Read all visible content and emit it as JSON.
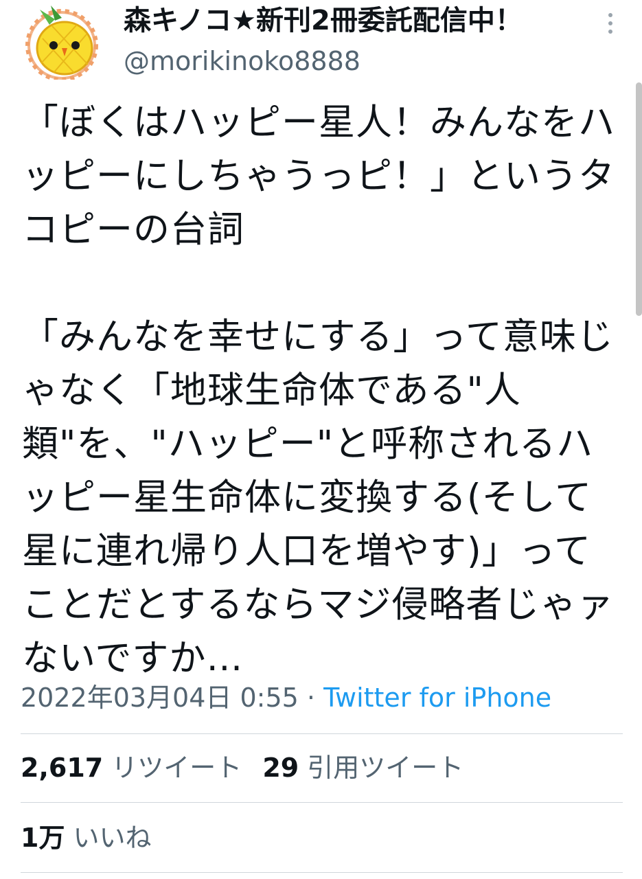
{
  "user": {
    "display_name": "森キノコ★新刊2冊委託配信中！",
    "handle": "@morikinoko8888",
    "avatar_icon": "pineapple-bird-icon"
  },
  "tweet": {
    "text": "「ぼくはハッピー星人！みんなをハッピーにしちゃうっピ！」というタコピーの台詞\n\n「みんなを幸せにする」って意味じゃなく「地球生命体である\"人類\"を、\"ハッピー\"と呼称されるハッピー星生命体に変換する(そして星に連れ帰り人口を増やす)」ってことだとするならマジ侵略者じゃァないですか…"
  },
  "meta": {
    "date": "2022年03月04日 0:55",
    "separator": " · ",
    "source": "Twitter for iPhone"
  },
  "stats": {
    "retweets_count": "2,617",
    "retweets_label": "リツイート",
    "quotes_count": "29",
    "quotes_label": "引用ツイート",
    "likes_count": "1万",
    "likes_label": "いいね"
  },
  "colors": {
    "text": "#0f1419",
    "secondary": "#536471",
    "link": "#1d9bf0",
    "divider": "#d0d6db"
  }
}
